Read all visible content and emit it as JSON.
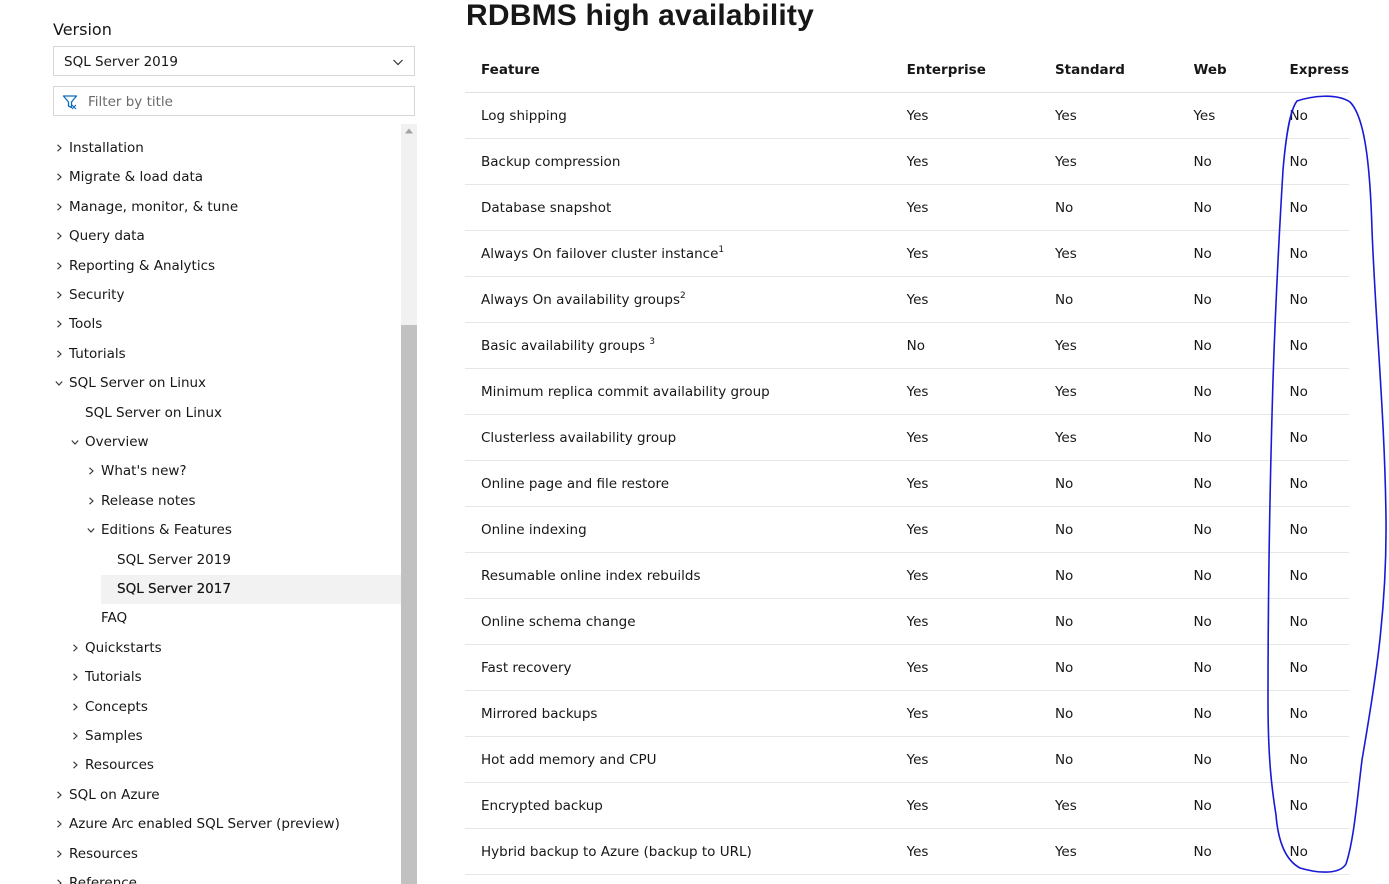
{
  "sidebar": {
    "version_label": "Version",
    "version_selected": "SQL Server 2019",
    "filter_placeholder": "Filter by title",
    "items": [
      {
        "label": "Installation",
        "level": 0,
        "state": "collapsed"
      },
      {
        "label": "Migrate & load data",
        "level": 0,
        "state": "collapsed"
      },
      {
        "label": "Manage, monitor, & tune",
        "level": 0,
        "state": "collapsed"
      },
      {
        "label": "Query data",
        "level": 0,
        "state": "collapsed"
      },
      {
        "label": "Reporting & Analytics",
        "level": 0,
        "state": "collapsed"
      },
      {
        "label": "Security",
        "level": 0,
        "state": "collapsed"
      },
      {
        "label": "Tools",
        "level": 0,
        "state": "collapsed"
      },
      {
        "label": "Tutorials",
        "level": 0,
        "state": "collapsed"
      },
      {
        "label": "SQL Server on Linux",
        "level": 0,
        "state": "expanded"
      },
      {
        "label": "SQL Server on Linux",
        "level": 1,
        "state": "leaf"
      },
      {
        "label": "Overview",
        "level": 1,
        "state": "expanded"
      },
      {
        "label": "What's new?",
        "level": 2,
        "state": "collapsed"
      },
      {
        "label": "Release notes",
        "level": 2,
        "state": "collapsed"
      },
      {
        "label": "Editions & Features",
        "level": 2,
        "state": "expanded"
      },
      {
        "label": "SQL Server 2019",
        "level": 3,
        "state": "leaf"
      },
      {
        "label": "SQL Server 2017",
        "level": 3,
        "state": "selected"
      },
      {
        "label": "FAQ",
        "level": 2,
        "state": "leaf"
      },
      {
        "label": "Quickstarts",
        "level": 1,
        "state": "collapsed"
      },
      {
        "label": "Tutorials",
        "level": 1,
        "state": "collapsed"
      },
      {
        "label": "Concepts",
        "level": 1,
        "state": "collapsed"
      },
      {
        "label": "Samples",
        "level": 1,
        "state": "collapsed"
      },
      {
        "label": "Resources",
        "level": 1,
        "state": "collapsed"
      },
      {
        "label": "SQL on Azure",
        "level": 0,
        "state": "collapsed"
      },
      {
        "label": "Azure Arc enabled SQL Server (preview)",
        "level": 0,
        "state": "collapsed"
      },
      {
        "label": "Resources",
        "level": 0,
        "state": "collapsed"
      },
      {
        "label": "Reference",
        "level": 0,
        "state": "collapsed"
      }
    ]
  },
  "main": {
    "title": "RDBMS high availability",
    "table": {
      "headers": [
        "Feature",
        "Enterprise",
        "Standard",
        "Web",
        "Express"
      ],
      "rows": [
        {
          "feature": "Log shipping",
          "sup": "",
          "values": [
            "Yes",
            "Yes",
            "Yes",
            "No"
          ]
        },
        {
          "feature": "Backup compression",
          "sup": "",
          "values": [
            "Yes",
            "Yes",
            "No",
            "No"
          ]
        },
        {
          "feature": "Database snapshot",
          "sup": "",
          "values": [
            "Yes",
            "No",
            "No",
            "No"
          ]
        },
        {
          "feature": "Always On failover cluster instance",
          "sup": "1",
          "values": [
            "Yes",
            "Yes",
            "No",
            "No"
          ]
        },
        {
          "feature": "Always On availability groups",
          "sup": "2",
          "values": [
            "Yes",
            "No",
            "No",
            "No"
          ]
        },
        {
          "feature": "Basic availability groups ",
          "sup": "3",
          "values": [
            "No",
            "Yes",
            "No",
            "No"
          ]
        },
        {
          "feature": "Minimum replica commit availability group",
          "sup": "",
          "values": [
            "Yes",
            "Yes",
            "No",
            "No"
          ]
        },
        {
          "feature": "Clusterless availability group",
          "sup": "",
          "values": [
            "Yes",
            "Yes",
            "No",
            "No"
          ]
        },
        {
          "feature": "Online page and file restore",
          "sup": "",
          "values": [
            "Yes",
            "No",
            "No",
            "No"
          ]
        },
        {
          "feature": "Online indexing",
          "sup": "",
          "values": [
            "Yes",
            "No",
            "No",
            "No"
          ]
        },
        {
          "feature": "Resumable online index rebuilds",
          "sup": "",
          "values": [
            "Yes",
            "No",
            "No",
            "No"
          ]
        },
        {
          "feature": "Online schema change",
          "sup": "",
          "values": [
            "Yes",
            "No",
            "No",
            "No"
          ]
        },
        {
          "feature": "Fast recovery",
          "sup": "",
          "values": [
            "Yes",
            "No",
            "No",
            "No"
          ]
        },
        {
          "feature": "Mirrored backups",
          "sup": "",
          "values": [
            "Yes",
            "No",
            "No",
            "No"
          ]
        },
        {
          "feature": "Hot add memory and CPU",
          "sup": "",
          "values": [
            "Yes",
            "No",
            "No",
            "No"
          ]
        },
        {
          "feature": "Encrypted backup",
          "sup": "",
          "values": [
            "Yes",
            "Yes",
            "No",
            "No"
          ]
        },
        {
          "feature": "Hybrid backup to Azure (backup to URL)",
          "sup": "",
          "values": [
            "Yes",
            "Yes",
            "No",
            "No"
          ]
        }
      ]
    }
  },
  "colors": {
    "annotation_ink": "#1a1ad6",
    "filter_icon": "#0f6cbd",
    "selected_bg": "#f2f2f2"
  },
  "icons": {
    "dropdown": "chevron-down-icon",
    "filter": "filter-icon",
    "collapsed": "chevron-right-icon",
    "expanded": "chevron-down-icon"
  }
}
